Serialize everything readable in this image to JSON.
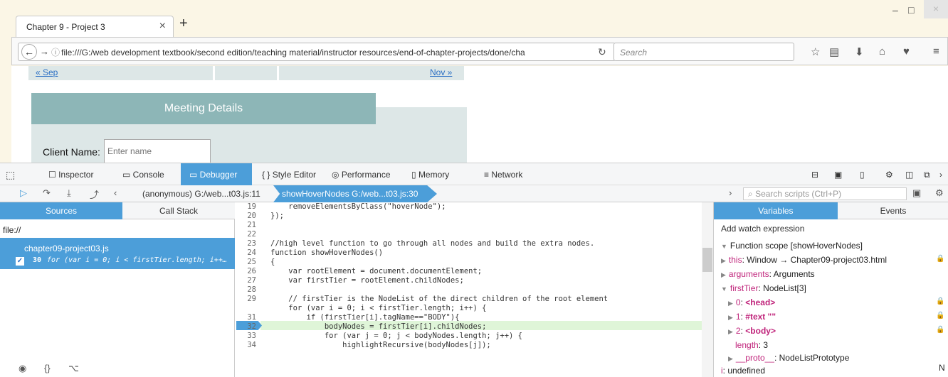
{
  "browser": {
    "tab_title": "Chapter 9 - Project 3",
    "tab_close": "×",
    "new_tab": "+",
    "url": "file:///G:/web development textbook/second edition/teaching material/instructor resources/end-of-chapter-projects/done/cha",
    "search_placeholder": "Search",
    "window_controls": [
      "–",
      "□",
      "×"
    ]
  },
  "page": {
    "prev_link": "« Sep",
    "next_link": "Nov »",
    "meeting_header": "Meeting Details",
    "client_label": "Client Name:",
    "client_placeholder": "Enter name"
  },
  "devtools": {
    "tabs": [
      "Inspector",
      "Console",
      "Debugger",
      "Style Editor",
      "Performance",
      "Memory",
      "Network"
    ],
    "active_tab": "Debugger",
    "crumb_1": "(anonymous) G:/web...t03.js:11",
    "crumb_2": "showHoverNodes G:/web...t03.js:30",
    "search_scripts_placeholder": "Search scripts (Ctrl+P)"
  },
  "left_pane": {
    "tabs": [
      "Sources",
      "Call Stack"
    ],
    "root": "file://",
    "source_file": "chapter09-project03.js",
    "breakpoint_line": "30",
    "breakpoint_text": "for (var i = 0; i < firstTier.length; i++…"
  },
  "editor": {
    "current_line": 30,
    "lines": [
      {
        "n": "19",
        "code": "    removeElementsByClass(\"hoverNode\");"
      },
      {
        "n": "20",
        "code": "});"
      },
      {
        "n": "21",
        "code": ""
      },
      {
        "n": "22",
        "code": ""
      },
      {
        "n": "23",
        "code": "//high level function to go through all nodes and build the extra nodes."
      },
      {
        "n": "24",
        "code": "function showHoverNodes()"
      },
      {
        "n": "25",
        "code": "{"
      },
      {
        "n": "26",
        "code": "    var rootElement = document.documentElement;"
      },
      {
        "n": "27",
        "code": "    var firstTier = rootElement.childNodes;"
      },
      {
        "n": "28",
        "code": ""
      },
      {
        "n": "29",
        "code": "    // firstTier is the NodeList of the direct children of the root element"
      },
      {
        "n": "30",
        "code": "    for (var i = 0; i < firstTier.length; i++) {"
      },
      {
        "n": "31",
        "code": "        if (firstTier[i].tagName==\"BODY\"){"
      },
      {
        "n": "32",
        "code": "            bodyNodes = firstTier[i].childNodes;"
      },
      {
        "n": "33",
        "code": "            for (var j = 0; j < bodyNodes.length; j++) {"
      },
      {
        "n": "34",
        "code": "                highlightRecursive(bodyNodes[j]);"
      }
    ]
  },
  "right_pane": {
    "tabs": [
      "Variables",
      "Events"
    ],
    "watch": "Add watch expression",
    "scope": "Function scope [showHoverNodes]",
    "vars": [
      {
        "key": "this",
        "val": "Window → Chapter09-project03.html"
      },
      {
        "key": "arguments",
        "val": "Arguments"
      },
      {
        "key": "firstTier",
        "val": "NodeList[3]"
      },
      {
        "key": "0",
        "val": "<head>"
      },
      {
        "key": "1",
        "val": "#text \"\""
      },
      {
        "key": "2",
        "val": "<body>"
      },
      {
        "key": "length",
        "val": "3"
      },
      {
        "key": "__proto__",
        "val": "NodeListPrototype"
      },
      {
        "key": "i",
        "val": "undefined"
      }
    ],
    "bottom_right": "N"
  }
}
